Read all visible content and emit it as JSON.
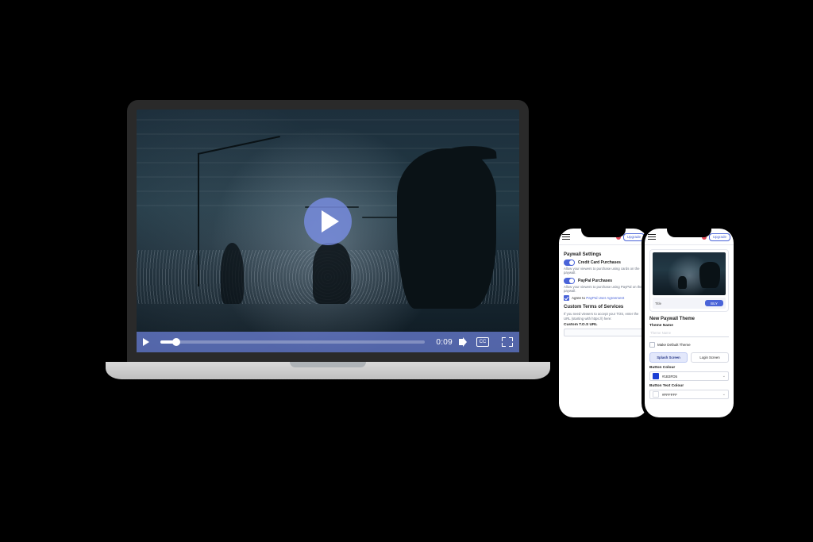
{
  "player": {
    "time": "0:09",
    "cc_label": "CC"
  },
  "header": {
    "upgrade": "Upgrade"
  },
  "phone_a": {
    "section_title": "Paywall Settings",
    "cc_label": "Credit Card Purchases",
    "cc_desc": "Allow your viewers to purchase using cards on the paywall.",
    "pp_label": "PayPal Purchases",
    "pp_desc": "Allow your viewers to purchase using PayPal on the paywall.",
    "agree_prefix": "Agree to ",
    "agree_link": "PayPal User Agreement",
    "tos_title": "Custom Terms of Services",
    "tos_desc": "If you need viewers to accept your TOS, enter the URL (starting with https://) here:",
    "tos_field_label": "Custom T.O.S URL",
    "tos_placeholder": ""
  },
  "phone_b": {
    "preview_title": "Title",
    "preview_btn": "BUY",
    "section_title": "New Paywall Theme",
    "name_label": "Theme Name",
    "name_placeholder": "Theme Name",
    "default_label": "Make Default Theme",
    "tab_a": "Splash Screen",
    "tab_b": "Login Screen",
    "btn_color_label": "Button Colour",
    "btn_color_value": "#1B3FD5",
    "btn_text_label": "Button Text Colour",
    "btn_text_value": "#FFFFFF",
    "swatch_btn": "#1B3FD5",
    "swatch_text": "#FFFFFF"
  }
}
